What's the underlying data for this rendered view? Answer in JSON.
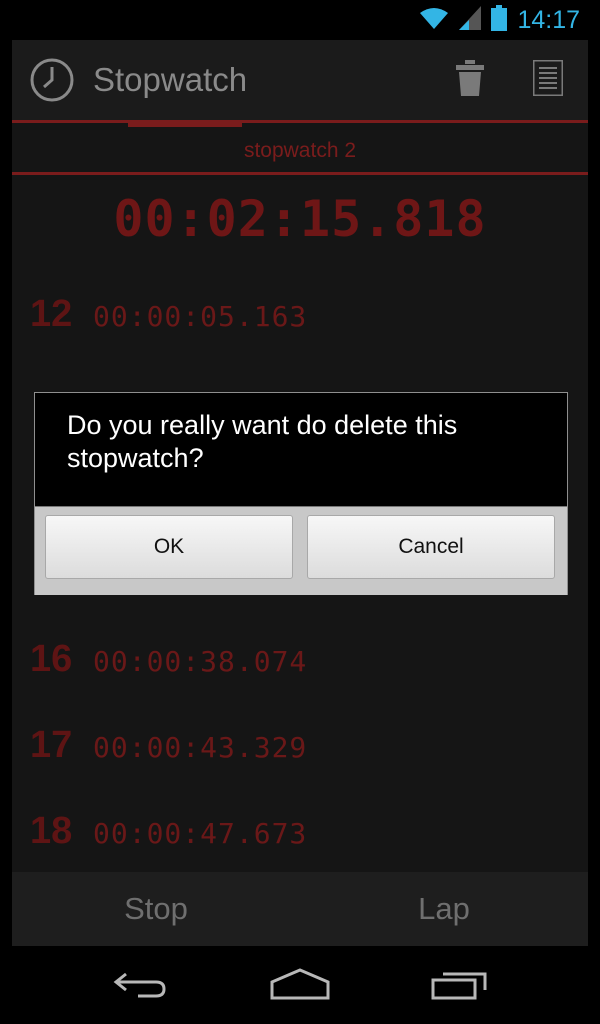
{
  "status_bar": {
    "time": "14:17",
    "icons": [
      "wifi-icon",
      "signal-icon",
      "battery-icon"
    ]
  },
  "action_bar": {
    "title": "Stopwatch",
    "icons": [
      "clock-icon",
      "trash-icon",
      "list-icon"
    ]
  },
  "tab": {
    "label": "stopwatch 2"
  },
  "main_time": "00:02:15.818",
  "laps": [
    {
      "num": "12",
      "time": "00:00:05.163"
    },
    {
      "num": "16",
      "time": "00:00:38.074"
    },
    {
      "num": "17",
      "time": "00:00:43.329"
    },
    {
      "num": "18",
      "time": "00:00:47.673"
    }
  ],
  "bottom_buttons": {
    "stop": "Stop",
    "lap": "Lap"
  },
  "dialog": {
    "message": "Do you really want do delete this stopwatch?",
    "ok_label": "OK",
    "cancel_label": "Cancel"
  },
  "nav": [
    "back-icon",
    "home-icon",
    "recents-icon"
  ],
  "colors": {
    "accent_red": "#7a1c1c",
    "status_blue": "#33b5e5"
  }
}
